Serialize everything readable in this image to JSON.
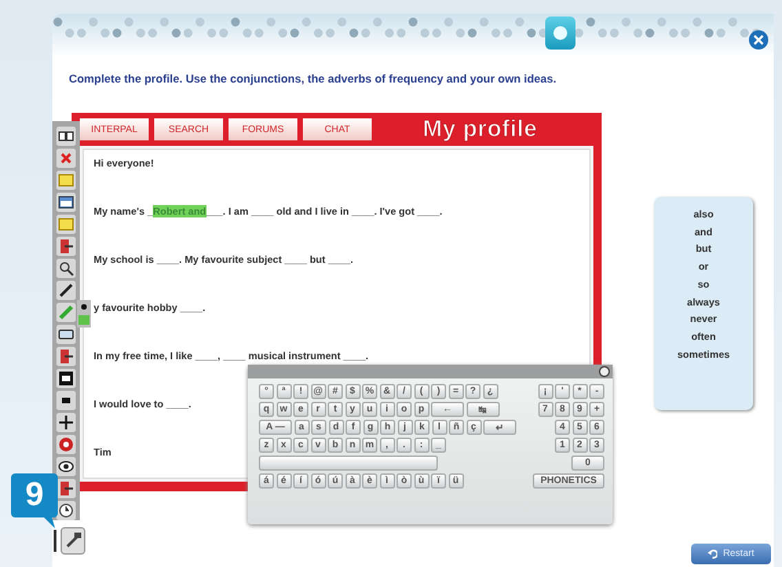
{
  "instruction": "Complete the profile. Use the conjunctions, the adverbs of frequency and your own ideas.",
  "tabs": [
    {
      "label": "INTERPAL",
      "selected": false
    },
    {
      "label": "SEARCH",
      "selected": false
    },
    {
      "label": "FORUMS",
      "selected": false
    },
    {
      "label": "CHAT",
      "selected": false
    }
  ],
  "profile_title": "My profile",
  "lines": [
    {
      "text": "Hi everyone!"
    },
    {
      "text": "My name's _",
      "answer": "Robert and",
      "rest": "___. I am ____ old and I live in ____. I've got ____."
    },
    {
      "text": "My school is ____. My favourite subject ____ but ____."
    },
    {
      "text": "y favourite hobby ____."
    },
    {
      "text": "In my free time, I like ____, ____ musical instrument ____."
    },
    {
      "text": "I would love to ____."
    },
    {
      "text": "Tim"
    }
  ],
  "word_bank": [
    "also",
    "and",
    "but",
    "or",
    "so",
    "always",
    "never",
    "often",
    "sometimes"
  ],
  "keyboard": {
    "rows": [
      {
        "main": [
          {
            "label": "°",
            "kind": "key"
          },
          {
            "label": "ª",
            "kind": "key"
          },
          {
            "label": "!",
            "kind": "key"
          },
          {
            "label": "@",
            "kind": "key"
          },
          {
            "label": "#",
            "kind": "key"
          },
          {
            "label": "$",
            "kind": "key"
          },
          {
            "label": "%",
            "kind": "key"
          },
          {
            "label": "&",
            "kind": "key"
          },
          {
            "label": "/",
            "kind": "key"
          },
          {
            "label": "(",
            "kind": "key"
          },
          {
            "label": ")",
            "kind": "key"
          },
          {
            "label": "=",
            "kind": "key"
          },
          {
            "label": "?",
            "kind": "key"
          },
          {
            "label": "¿",
            "kind": "key"
          }
        ],
        "pad": [
          {
            "label": "¡",
            "kind": "key"
          },
          {
            "label": "'",
            "kind": "key"
          },
          {
            "label": "*",
            "kind": "key"
          },
          {
            "label": "-",
            "kind": "key"
          }
        ]
      },
      {
        "main": [
          {
            "label": "q",
            "kind": "key"
          },
          {
            "label": "w",
            "kind": "key"
          },
          {
            "label": "e",
            "kind": "key"
          },
          {
            "label": "r",
            "kind": "key"
          },
          {
            "label": "t",
            "kind": "key"
          },
          {
            "label": "y",
            "kind": "key"
          },
          {
            "label": "u",
            "kind": "key"
          },
          {
            "label": "i",
            "kind": "key"
          },
          {
            "label": "o",
            "kind": "key"
          },
          {
            "label": "p",
            "kind": "key"
          },
          {
            "label": "←",
            "kind": "wide"
          },
          {
            "label": "↹",
            "kind": "wide"
          }
        ],
        "pad": [
          {
            "label": "7",
            "kind": "key"
          },
          {
            "label": "8",
            "kind": "key"
          },
          {
            "label": "9",
            "kind": "key"
          },
          {
            "label": "+",
            "kind": "key"
          }
        ]
      },
      {
        "main": [
          {
            "label": "A —",
            "kind": "wide"
          },
          {
            "label": "a",
            "kind": "key"
          },
          {
            "label": "s",
            "kind": "key"
          },
          {
            "label": "d",
            "kind": "key"
          },
          {
            "label": "f",
            "kind": "key"
          },
          {
            "label": "g",
            "kind": "key"
          },
          {
            "label": "h",
            "kind": "key"
          },
          {
            "label": "j",
            "kind": "key"
          },
          {
            "label": "k",
            "kind": "key"
          },
          {
            "label": "l",
            "kind": "key"
          },
          {
            "label": "ñ",
            "kind": "key"
          },
          {
            "label": "ç",
            "kind": "key"
          },
          {
            "label": "↵",
            "kind": "wide"
          }
        ],
        "pad": [
          {
            "label": "4",
            "kind": "key"
          },
          {
            "label": "5",
            "kind": "key"
          },
          {
            "label": "6",
            "kind": "key"
          }
        ]
      },
      {
        "main": [
          {
            "label": "z",
            "kind": "key"
          },
          {
            "label": "x",
            "kind": "key"
          },
          {
            "label": "c",
            "kind": "key"
          },
          {
            "label": "v",
            "kind": "key"
          },
          {
            "label": "b",
            "kind": "key"
          },
          {
            "label": "n",
            "kind": "key"
          },
          {
            "label": "m",
            "kind": "key"
          },
          {
            "label": ",",
            "kind": "key"
          },
          {
            "label": ".",
            "kind": "key"
          },
          {
            "label": ":",
            "kind": "key"
          },
          {
            "label": "_",
            "kind": "key"
          }
        ],
        "pad": [
          {
            "label": "1",
            "kind": "key"
          },
          {
            "label": "2",
            "kind": "key"
          },
          {
            "label": "3",
            "kind": "key"
          }
        ]
      },
      {
        "main": [
          {
            "kind": "space"
          }
        ],
        "pad": [
          {
            "label": "0",
            "kind": "wide"
          }
        ]
      },
      {
        "main": [
          {
            "label": "á",
            "kind": "key"
          },
          {
            "label": "é",
            "kind": "key"
          },
          {
            "label": "í",
            "kind": "key"
          },
          {
            "label": "ó",
            "kind": "key"
          },
          {
            "label": "ú",
            "kind": "key"
          },
          {
            "label": "à",
            "kind": "key"
          },
          {
            "label": "è",
            "kind": "key"
          },
          {
            "label": "ì",
            "kind": "key"
          },
          {
            "label": "ò",
            "kind": "key"
          },
          {
            "label": "ù",
            "kind": "key"
          },
          {
            "label": "ï",
            "kind": "key"
          },
          {
            "label": "ü",
            "kind": "key"
          }
        ],
        "pad": [
          {
            "label": "PHONETICS",
            "kind": "label"
          }
        ]
      }
    ]
  },
  "restart": "Restart",
  "badge": "9"
}
